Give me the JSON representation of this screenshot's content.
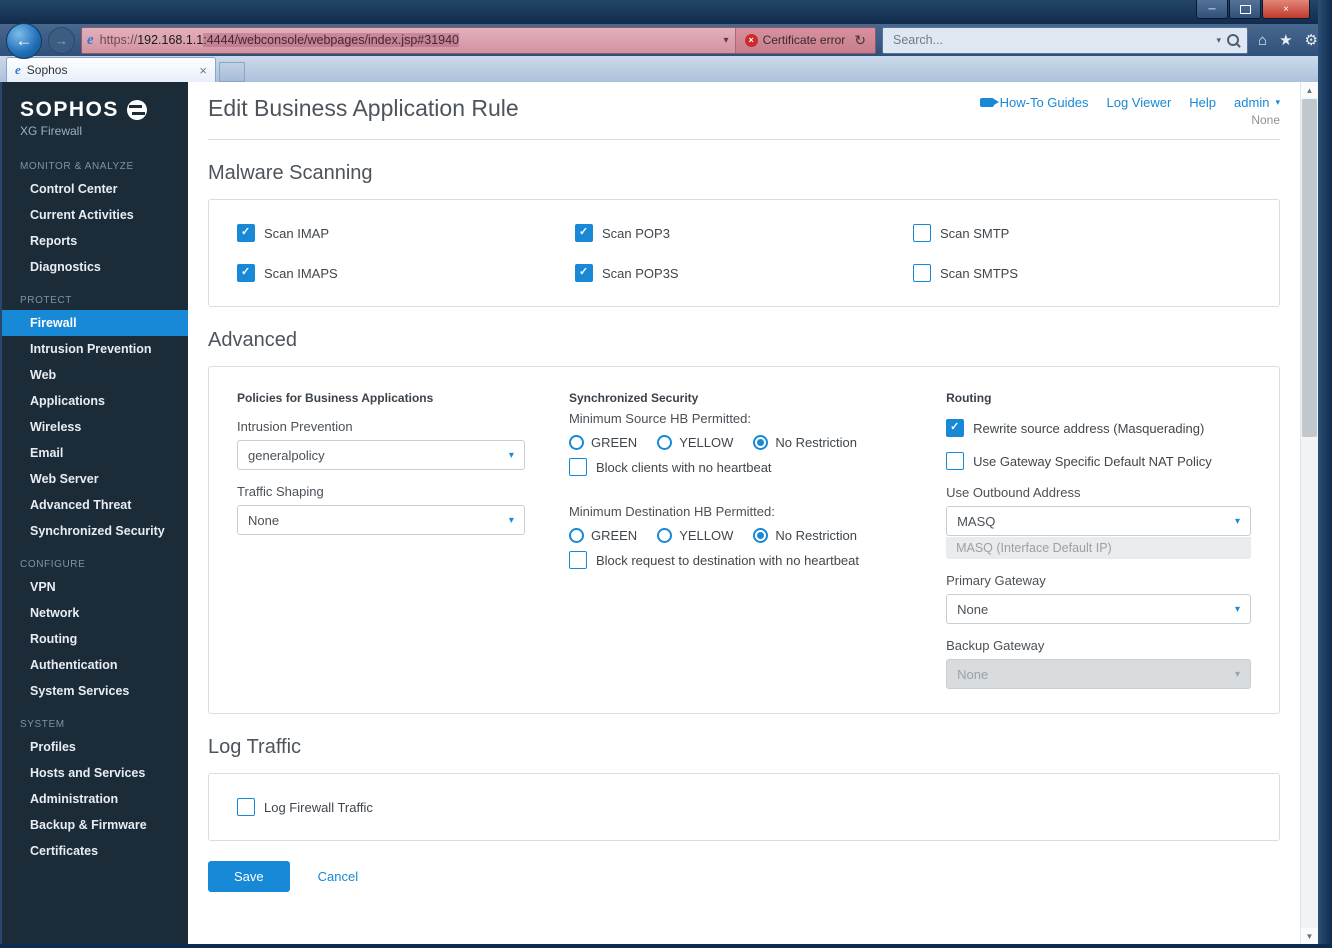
{
  "theme": {
    "accent": "#1789d6",
    "sidebar_bg": "#1b2b38",
    "close_red": "#bf3a2b",
    "cert_red": "#cc2b2b"
  },
  "icons": {
    "back": "←",
    "forward": "→",
    "chevron_down": "▾",
    "refresh": "↻",
    "close": "×",
    "minimize": "─",
    "home": "⌂",
    "star": "★",
    "gear": "⚙",
    "scroll_up": "▲",
    "scroll_down": "▼",
    "ie": "e",
    "cert_x": "×",
    "tab_close": "×",
    "admin_caret": "▾"
  },
  "browser": {
    "tab_title": "Sophos",
    "url_scheme": "https://",
    "url_host": "192.168.1.1",
    "url_path": ":4444/webconsole/webpages/index.jsp#31940",
    "cert_error": "Certificate error",
    "search_placeholder": "Search..."
  },
  "sidebar": {
    "logo": "SOPHOS",
    "logo_sub": "XG Firewall",
    "sections": [
      {
        "label": "MONITOR & ANALYZE",
        "items": [
          {
            "label": "Control Center"
          },
          {
            "label": "Current Activities"
          },
          {
            "label": "Reports"
          },
          {
            "label": "Diagnostics"
          }
        ]
      },
      {
        "label": "PROTECT",
        "items": [
          {
            "label": "Firewall",
            "active": true
          },
          {
            "label": "Intrusion Prevention"
          },
          {
            "label": "Web"
          },
          {
            "label": "Applications"
          },
          {
            "label": "Wireless"
          },
          {
            "label": "Email"
          },
          {
            "label": "Web Server"
          },
          {
            "label": "Advanced Threat"
          },
          {
            "label": "Synchronized Security"
          }
        ]
      },
      {
        "label": "CONFIGURE",
        "items": [
          {
            "label": "VPN"
          },
          {
            "label": "Network"
          },
          {
            "label": "Routing"
          },
          {
            "label": "Authentication"
          },
          {
            "label": "System Services"
          }
        ]
      },
      {
        "label": "SYSTEM",
        "items": [
          {
            "label": "Profiles"
          },
          {
            "label": "Hosts and Services"
          },
          {
            "label": "Administration"
          },
          {
            "label": "Backup & Firmware"
          },
          {
            "label": "Certificates"
          }
        ]
      }
    ]
  },
  "header": {
    "title": "Edit Business Application Rule",
    "howto": "How-To Guides",
    "log_viewer": "Log Viewer",
    "help": "Help",
    "user": "admin",
    "user_sub": "None"
  },
  "malware": {
    "heading": "Malware Scanning",
    "items": [
      {
        "label": "Scan IMAP",
        "checked": true
      },
      {
        "label": "Scan POP3",
        "checked": true
      },
      {
        "label": "Scan SMTP",
        "checked": false
      },
      {
        "label": "Scan IMAPS",
        "checked": true
      },
      {
        "label": "Scan POP3S",
        "checked": true
      },
      {
        "label": "Scan SMTPS",
        "checked": false
      }
    ]
  },
  "advanced": {
    "heading": "Advanced",
    "policies": {
      "heading": "Policies for Business Applications",
      "ips_label": "Intrusion Prevention",
      "ips_value": "generalpolicy",
      "shaping_label": "Traffic Shaping",
      "shaping_value": "None"
    },
    "sync": {
      "heading": "Synchronized Security",
      "source_label": "Minimum Source HB Permitted:",
      "source_options": [
        {
          "label": "GREEN",
          "selected": false
        },
        {
          "label": "YELLOW",
          "selected": false
        },
        {
          "label": "No Restriction",
          "selected": true
        }
      ],
      "source_block": {
        "label": "Block clients with no heartbeat",
        "checked": false
      },
      "dest_label": "Minimum Destination HB Permitted:",
      "dest_options": [
        {
          "label": "GREEN",
          "selected": false
        },
        {
          "label": "YELLOW",
          "selected": false
        },
        {
          "label": "No Restriction",
          "selected": true
        }
      ],
      "dest_block": {
        "label": "Block request to destination with no heartbeat",
        "checked": false
      }
    },
    "routing": {
      "heading": "Routing",
      "masq": {
        "label": "Rewrite source address (Masquerading)",
        "checked": true
      },
      "nat": {
        "label": "Use Gateway Specific Default NAT Policy",
        "checked": false
      },
      "outbound_label": "Use Outbound Address",
      "outbound_value": "MASQ",
      "outbound_hint": "MASQ (Interface Default IP)",
      "primary_label": "Primary Gateway",
      "primary_value": "None",
      "backup_label": "Backup Gateway",
      "backup_value": "None",
      "backup_disabled": true
    }
  },
  "log_traffic": {
    "heading": "Log Traffic",
    "item": {
      "label": "Log Firewall Traffic",
      "checked": false
    }
  },
  "footer": {
    "save": "Save",
    "cancel": "Cancel"
  }
}
